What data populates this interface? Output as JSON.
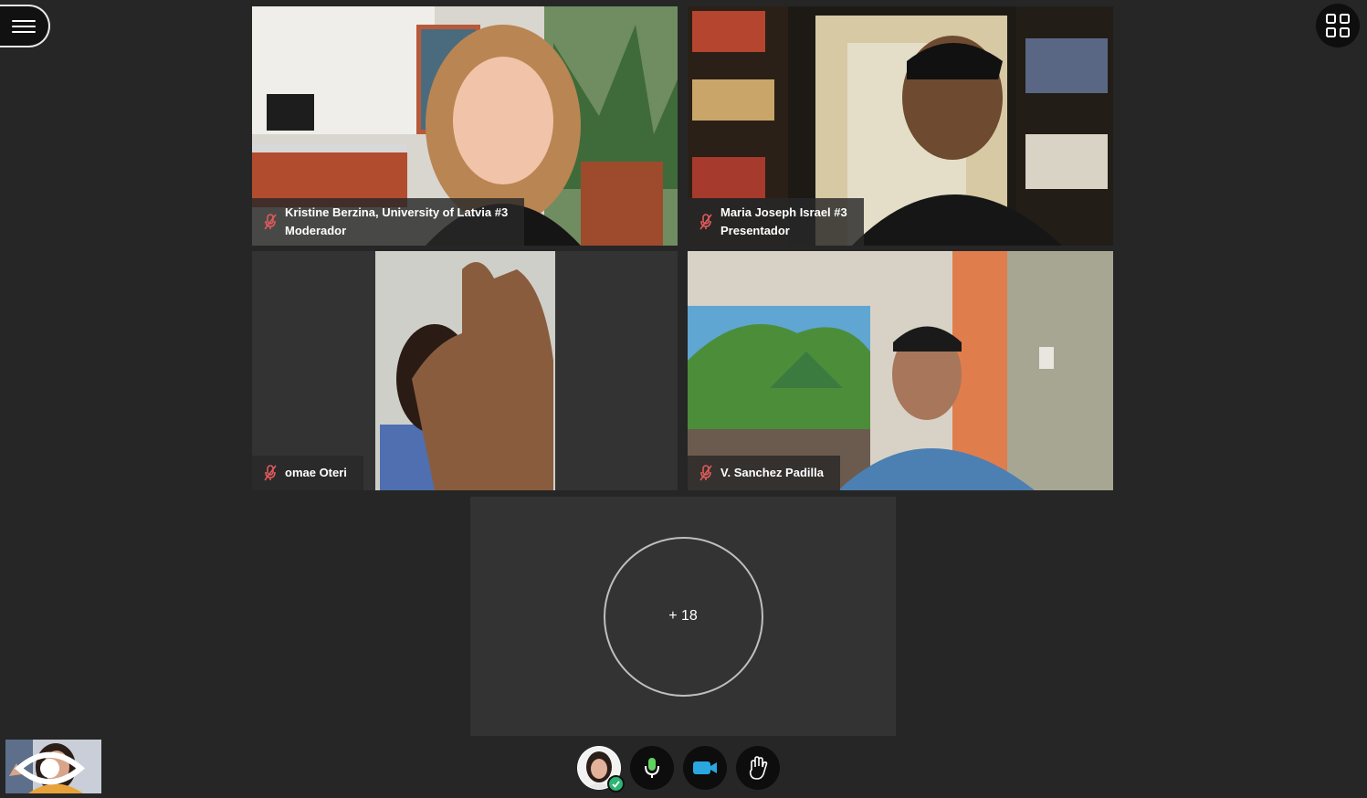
{
  "toolbar": {
    "menu_icon": "hamburger-icon",
    "layout_icon": "grid-layout-icon"
  },
  "participants": [
    {
      "name": "Kristine Berzina, University of Latvia #3",
      "role": "Moderador",
      "mic": "muted"
    },
    {
      "name": "Maria Joseph Israel #3",
      "role": "Presentador",
      "mic": "muted"
    },
    {
      "name": "omae Oteri",
      "role": "",
      "mic": "muted"
    },
    {
      "name": "V. Sanchez Padilla",
      "role": "",
      "mic": "muted"
    }
  ],
  "overflow": {
    "label": "+ 18"
  },
  "self_view": {
    "icon": "eye-icon"
  },
  "controls": {
    "avatar_status": "available",
    "mic_icon": "microphone-icon",
    "camera_icon": "video-camera-icon",
    "raise_hand_icon": "raise-hand-icon"
  },
  "colors": {
    "background": "#262626",
    "tile": "#333333",
    "muted_icon": "#e05a5a",
    "status_ok": "#2bb673",
    "mic_green": "#5fd35f",
    "camera_blue": "#2aa7df"
  }
}
